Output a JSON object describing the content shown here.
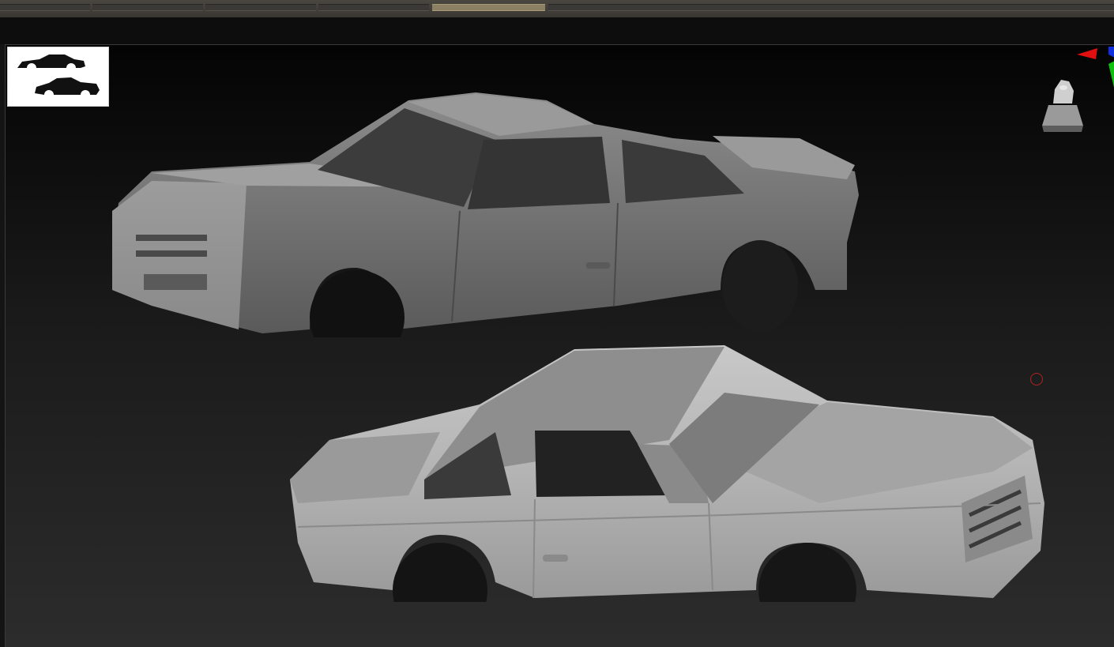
{
  "app": {
    "name": "3d-sculpt-viewport"
  },
  "toolbar": {
    "segments": [
      {
        "id": "seg-1",
        "active": false
      },
      {
        "id": "seg-2",
        "active": false
      },
      {
        "id": "seg-3",
        "active": false
      },
      {
        "id": "seg-4",
        "active": true
      },
      {
        "id": "seg-5",
        "active": false
      }
    ]
  },
  "viewport": {
    "thumbnail_icon": "car-silhouettes-icon",
    "axis_gizmo": {
      "x_color": "#e01010",
      "y_color": "#10c010",
      "z_color": "#1030e0"
    },
    "nav_cube_icon": "navigation-cube-icon",
    "cursor_color": "#b02222",
    "models": [
      {
        "name": "car-body-shell-rear-view",
        "color": "#8a8a8a"
      },
      {
        "name": "car-body-shell-front-view",
        "color": "#bdbdbd"
      }
    ]
  }
}
